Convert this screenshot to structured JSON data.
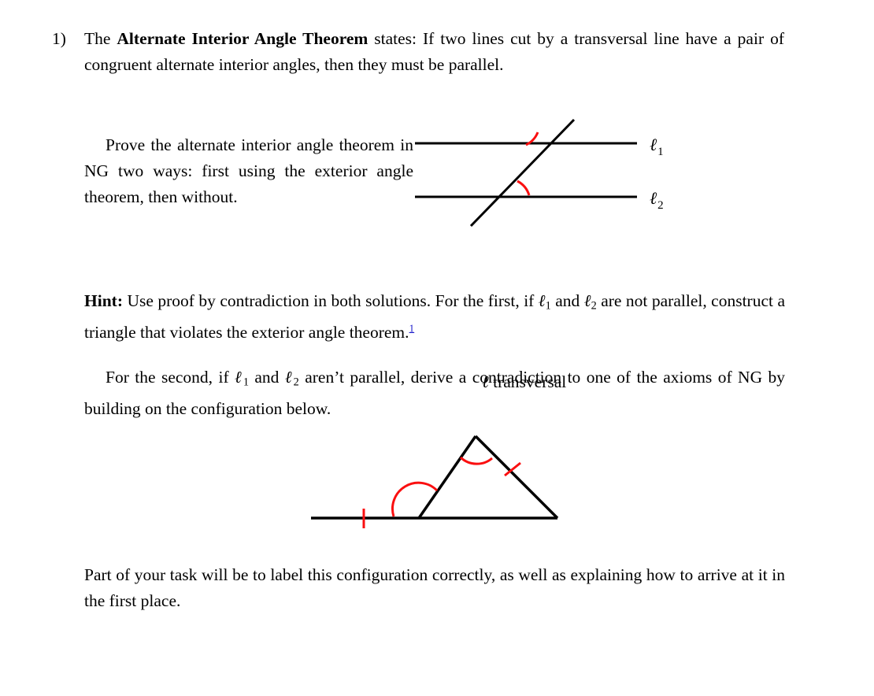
{
  "document": {
    "type": "math-exercise-worksheet",
    "background_color": "#ffffff",
    "text_color": "#000000",
    "accent_red": "#fa0f10",
    "link_blue": "#2222cc"
  },
  "item": {
    "number": "1)",
    "statement": {
      "lead": "The ",
      "theorem_name": "Alternate Interior Angle Theorem",
      "rest": " states: If two lines cut by a transversal line have a pair of congruent alternate interior angles, then they must be parallel."
    },
    "prove_paragraph": "Prove the alternate interior angle theorem in NG two ways: first using the exterior angle theorem, then without."
  },
  "figure_lines": {
    "caption_ell": "ℓ",
    "caption_text": " transversal",
    "label_line1": "ℓ",
    "label_line1_sub": "1",
    "label_line2": "ℓ",
    "label_line2_sub": "2",
    "angle_marks": 2,
    "angle_color": "#fa0f10",
    "line_color": "#000000",
    "description": "two horizontal parallel lines cut by a transversal with two red congruent alternate interior angle arcs"
  },
  "hint": {
    "label": "Hint:",
    "body_part1": " Use proof by contradiction in both solutions. For the first, if ",
    "ell1": "ℓ",
    "ell1_sub": "1",
    "body_part2": " and ",
    "ell2": "ℓ",
    "ell2_sub": "2",
    "body_part3": " are not parallel, construct a triangle that violates the exterior angle theorem.",
    "footnote_marker": "1"
  },
  "second": {
    "part1": "For the second, if ",
    "ell1": "ℓ",
    "ell1_sub": "1",
    "part2": " and ",
    "ell2": "ℓ",
    "ell2_sub": "2",
    "part3": " aren’t parallel, derive a contradiction to one of the axioms of NG by building on the configuration below."
  },
  "figure_triangle": {
    "description": "a triangle sitting on an extended base line, with a red arc at the apex, a red arc at the exterior/interior angle of the bottom-left vertex, a red tick on the right side and a red tick on the base extension",
    "angle_color": "#fa0f10",
    "line_color": "#000000",
    "arcs": 2,
    "ticks": 2
  },
  "final_paragraph": "Part of your task will be to label this configuration correctly, as well as explaining how to arrive at it in the first place."
}
